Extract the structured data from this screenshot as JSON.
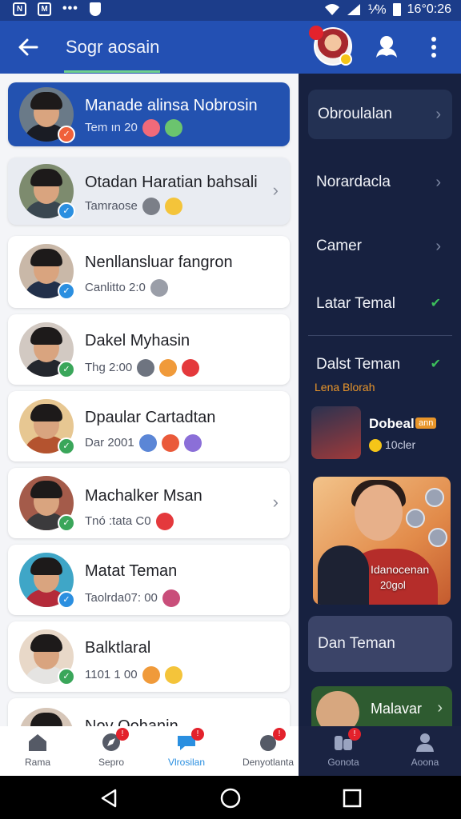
{
  "statusbar": {
    "left_icon_1": "N",
    "left_icon_2": "M",
    "dots": "•••",
    "battery_label": "⅟%",
    "time": "16°0:26"
  },
  "appbar": {
    "title": "Sogr aosain",
    "icons": [
      "back-arrow-icon",
      "person-icon",
      "more-vert-icon"
    ]
  },
  "chats": [
    {
      "name": "Manade alinsa Nobrosin",
      "sub": "Tem ın 20",
      "emojis": [
        "#f06a7a",
        "#6bc46e"
      ],
      "badge": "#f0603a",
      "chevron": false,
      "style": "active"
    },
    {
      "name": "Otadan Haratian bahsali",
      "sub": "Tamraose",
      "emojis": [
        "#7b7f88",
        "#f4c43a"
      ],
      "badge": "#2b8fe0",
      "chevron": true,
      "style": "soft"
    },
    {
      "name": "Nenllansluar fangron",
      "sub": "Canlitto 2:0",
      "emojis": [
        "#9a9ea8"
      ],
      "badge": "#2b8fe0",
      "chevron": false,
      "style": "plain"
    },
    {
      "name": "Dakel Myhasin",
      "sub": "Thg 2:00",
      "emojis": [
        "#6e7480",
        "#f09a3a",
        "#e4393c"
      ],
      "badge": "#3aa65a",
      "chevron": false,
      "style": "plain"
    },
    {
      "name": "Dpaular Cartadtan",
      "sub": "Dar 2001",
      "emojis": [
        "#5b86d6",
        "#ea5a3a",
        "#8b6fd8"
      ],
      "badge": "#3aa65a",
      "chevron": false,
      "style": "plain"
    },
    {
      "name": "Machalker Msan",
      "sub": "Tnó :tata C0",
      "emojis": [
        "#e4393c"
      ],
      "badge": "#3aa65a",
      "chevron": true,
      "style": "plain"
    },
    {
      "name": "Matat Teman",
      "sub": "Taolrda07: 00",
      "emojis": [
        "#c94e7a"
      ],
      "badge": "#2b8fe0",
      "chevron": false,
      "style": "plain"
    },
    {
      "name": "Balktlaral",
      "sub": "1101 1 00",
      "emojis": [
        "#f09a3a",
        "#f4c43a"
      ],
      "badge": "#3aa65a",
      "chevron": false,
      "style": "plain"
    },
    {
      "name": "Nov Oohanin",
      "sub": "",
      "emojis": [],
      "badge": "#3aa65a",
      "chevron": false,
      "style": "plain"
    }
  ],
  "side": {
    "items": [
      {
        "label": "Obroulalan",
        "icon": "chevron-right"
      },
      {
        "label": "Norardacla",
        "icon": "chevron-right"
      },
      {
        "label": "Camer",
        "icon": "chevron-right"
      },
      {
        "label": "Latar Temal",
        "icon": "check"
      },
      {
        "label": "Dalst Teman",
        "icon": "check"
      }
    ],
    "subtitle": "Lena Blorah",
    "feature": {
      "name": "Dobeal",
      "tag": "ann",
      "sub": "10cler"
    },
    "banner": {
      "name": "Idanocenan",
      "sub": "20gol"
    },
    "button": "Dan Teman",
    "mini": {
      "name": "Malavar"
    }
  },
  "bottomnav": [
    {
      "label": "Rama",
      "icon": "home-icon",
      "badge": false,
      "active": false
    },
    {
      "label": "Sepro",
      "icon": "compass-icon",
      "badge": true,
      "active": false
    },
    {
      "label": "Vlrosilan",
      "icon": "chat-icon",
      "badge": true,
      "active": true
    },
    {
      "label": "Denyotlanta",
      "icon": "bell-icon",
      "badge": true,
      "active": false
    },
    {
      "label": "Gonota",
      "icon": "group-icon",
      "badge": true,
      "active": false
    },
    {
      "label": "Aoona",
      "icon": "profile-icon",
      "badge": false,
      "active": false
    }
  ],
  "colors": {
    "appbar": "#2350b3",
    "side_panel": "#172140",
    "accent_active": "#2a8fe0",
    "check": "#3cbf5b",
    "badge_red": "#e3222c"
  }
}
